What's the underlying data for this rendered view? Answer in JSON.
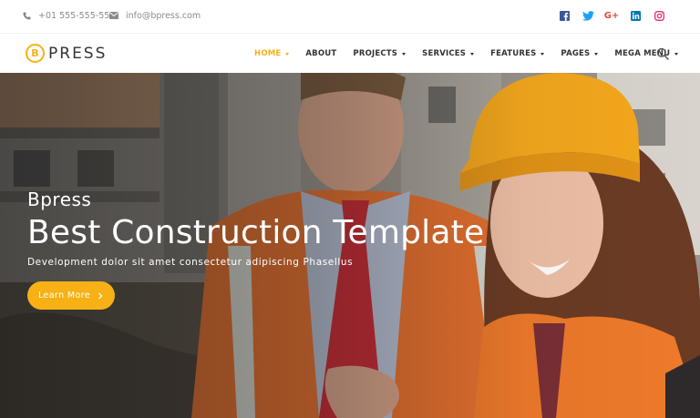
{
  "topbar": {
    "phone": "+01 555-555-555",
    "email": "info@bpress.com",
    "social": [
      {
        "icon": "facebook-icon",
        "color": "#3b5998"
      },
      {
        "icon": "twitter-icon",
        "color": "#1da1f2"
      },
      {
        "icon": "google-plus-icon",
        "color": "#dd4b39",
        "label": "G+"
      },
      {
        "icon": "linkedin-icon",
        "color": "#0077b5"
      },
      {
        "icon": "instagram-icon",
        "color": "#e1306c"
      }
    ]
  },
  "logo": {
    "mark": "B",
    "text": "PRESS"
  },
  "nav": {
    "items": [
      {
        "label": "HOME",
        "dropdown": true,
        "active": true
      },
      {
        "label": "ABOUT",
        "dropdown": false
      },
      {
        "label": "PROJECTS",
        "dropdown": true
      },
      {
        "label": "SERVICES",
        "dropdown": true
      },
      {
        "label": "FEATURES",
        "dropdown": true
      },
      {
        "label": "PAGES",
        "dropdown": true
      },
      {
        "label": "MEGA MENU",
        "dropdown": true
      }
    ],
    "search_icon": "search-icon"
  },
  "hero": {
    "subtitle": "Bpress",
    "title": "Best Construction Template",
    "description": "Development dolor sit amet consectetur adipiscing Phasellus",
    "cta_label": "Learn More",
    "cta_icon": "chevron-right-icon"
  },
  "colors": {
    "accent": "#f7b114",
    "text_dark": "#333333",
    "text_muted": "#8a8a8a"
  }
}
